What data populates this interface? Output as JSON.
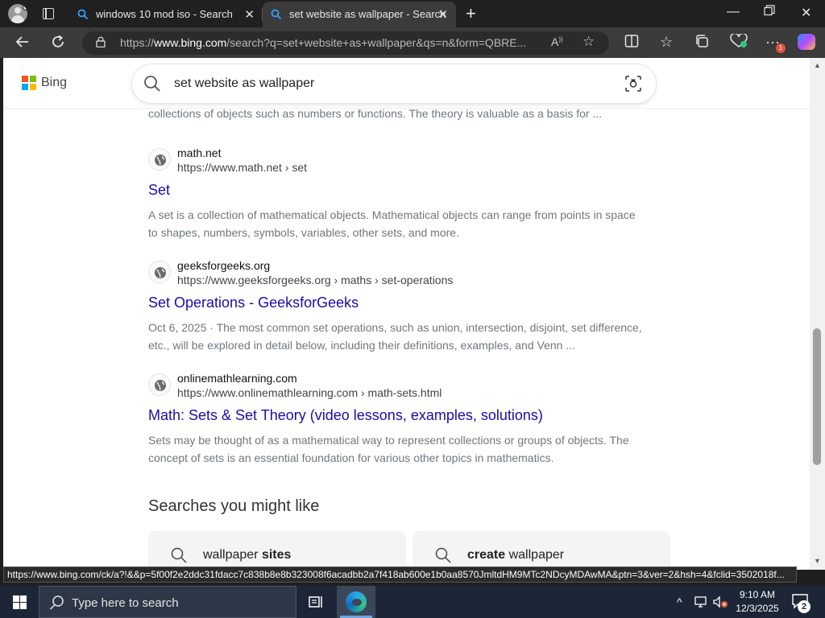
{
  "browser": {
    "tabs": [
      {
        "title": "windows 10 mod iso - Search",
        "active": false
      },
      {
        "title": "set website as wallpaper - Search",
        "active": true
      }
    ],
    "address_prefix": "https://",
    "address_host": "www.bing.com",
    "address_rest": "/search?q=set+website+as+wallpaper&qs=n&form=QBRE...",
    "extension_badge_count": "1",
    "colors": {
      "tab_strip": "#202020",
      "toolbar": "#3b3b3b",
      "accent": "#2f8cff"
    }
  },
  "bing": {
    "brand": "Bing",
    "query": "set website as wallpaper",
    "top_snippet_cut": "collections of objects such as numbers or functions. The theory is valuable as a basis for ...",
    "results": [
      {
        "site": "math.net",
        "cite": "https://www.math.net › set",
        "title": "Set",
        "snippet": "A set is a collection of mathematical objects. Mathematical objects can range from points in space to shapes, numbers, symbols, variables, other sets, and more."
      },
      {
        "site": "geeksforgeeks.org",
        "cite": "https://www.geeksforgeeks.org › maths › set-operations",
        "title": "Set Operations - GeeksforGeeks",
        "snippet": "Oct 6, 2025 · The most common set operations, such as union, intersection, disjoint, set difference, etc., will be explored in detail below, including their definitions, examples, and Venn ..."
      },
      {
        "site": "onlinemathlearning.com",
        "cite": "https://www.onlinemathlearning.com › math-sets.html",
        "title": "Math: Sets & Set Theory (video lessons, examples, solutions)",
        "snippet": "Sets may be thought of as a mathematical way to represent collections or groups of objects. The concept of sets is an essential foundation for various other topics in mathematics."
      }
    ],
    "related_heading": "Searches you might like",
    "related": [
      {
        "plain": "wallpaper ",
        "bold": "sites",
        "bold_first": false
      },
      {
        "plain": " wallpaper",
        "bold": "create",
        "bold_first": true
      }
    ],
    "colors": {
      "link": "#1a0dab",
      "snippet": "#71777d"
    }
  },
  "status_url": "https://www.bing.com/ck/a?!&&p=5f00f2e2ddc31fdacc7c838b8e8b323008f6acadbb2a7f418ab600e1b0aa8570JmltdHM9MTc2NDcyMDAwMA&ptn=3&ver=2&hsh=4&fclid=3502018f...",
  "taskbar": {
    "search_placeholder": "Type here to search",
    "time": "9:10 AM",
    "date": "12/3/2025",
    "notification_count": "2",
    "colors": {
      "background": "#1c2637"
    }
  }
}
